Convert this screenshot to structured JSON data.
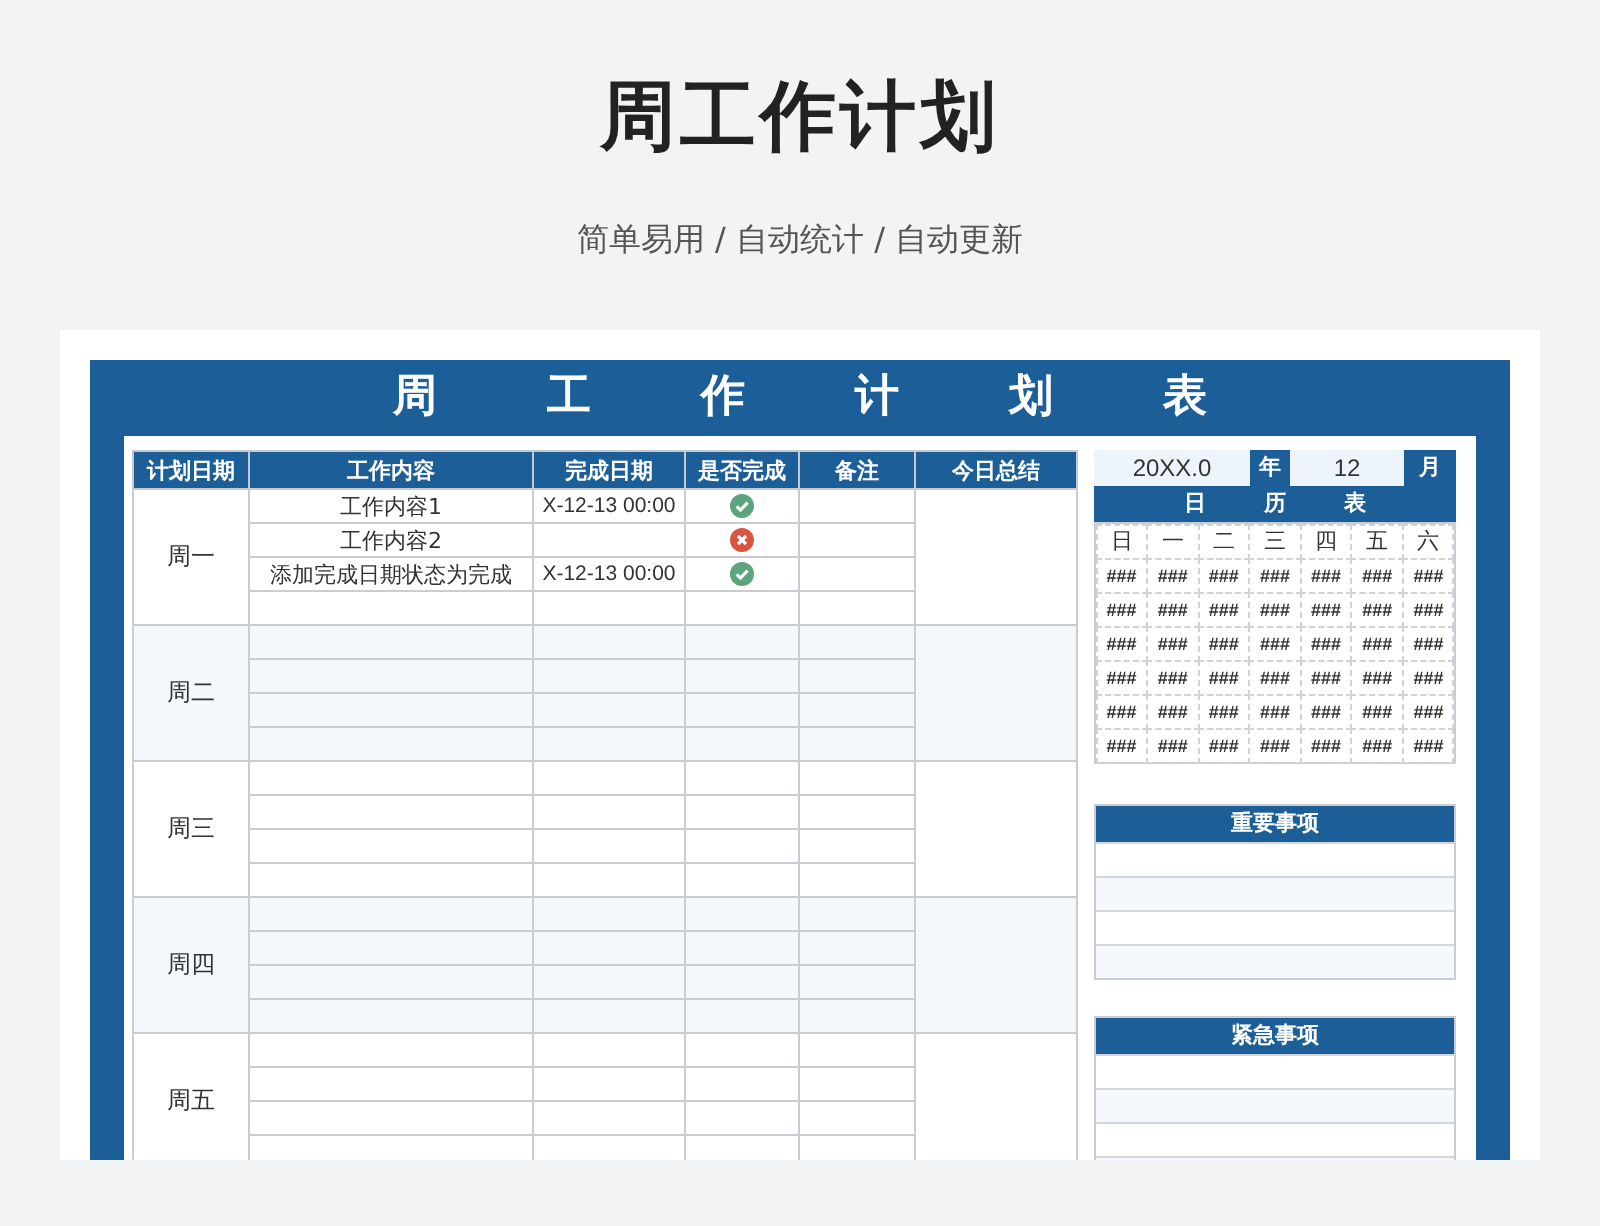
{
  "page": {
    "title": "周工作计划",
    "subtitle": "简单易用 / 自动统计 / 自动更新"
  },
  "sheet": {
    "title": "周工作计划表",
    "columns": [
      "计划日期",
      "工作内容",
      "完成日期",
      "是否完成",
      "备注",
      "今日总结"
    ],
    "days": [
      {
        "name": "周一",
        "tasks": [
          {
            "content": "工作内容1",
            "date": "X-12-13 00:00",
            "done": true
          },
          {
            "content": "工作内容2",
            "done": false
          },
          {
            "content": "添加完成日期状态为完成",
            "date": "X-12-13 00:00",
            "done": true
          }
        ]
      },
      {
        "name": "周二"
      },
      {
        "name": "周三"
      },
      {
        "name": "周四"
      },
      {
        "name": "周五"
      }
    ]
  },
  "calendar": {
    "year": "20XX.0",
    "year_label": "年",
    "month": "12",
    "month_label": "月",
    "title": "日历表",
    "weekdays": [
      "日",
      "一",
      "二",
      "三",
      "四",
      "五",
      "六"
    ],
    "weeks": [
      [
        "###",
        "###",
        "###",
        "###",
        "###",
        "###",
        "###"
      ],
      [
        "###",
        "###",
        "###",
        "###",
        "###",
        "###",
        "###"
      ],
      [
        "###",
        "###",
        "###",
        "###",
        "###",
        "###",
        "###"
      ],
      [
        "###",
        "###",
        "###",
        "###",
        "###",
        "###",
        "###"
      ],
      [
        "###",
        "###",
        "###",
        "###",
        "###",
        "###",
        "###"
      ],
      [
        "###",
        "###",
        "###",
        "###",
        "###",
        "###",
        "###"
      ]
    ]
  },
  "lists": [
    {
      "title": "重要事项"
    },
    {
      "title": "紧急事项"
    }
  ]
}
